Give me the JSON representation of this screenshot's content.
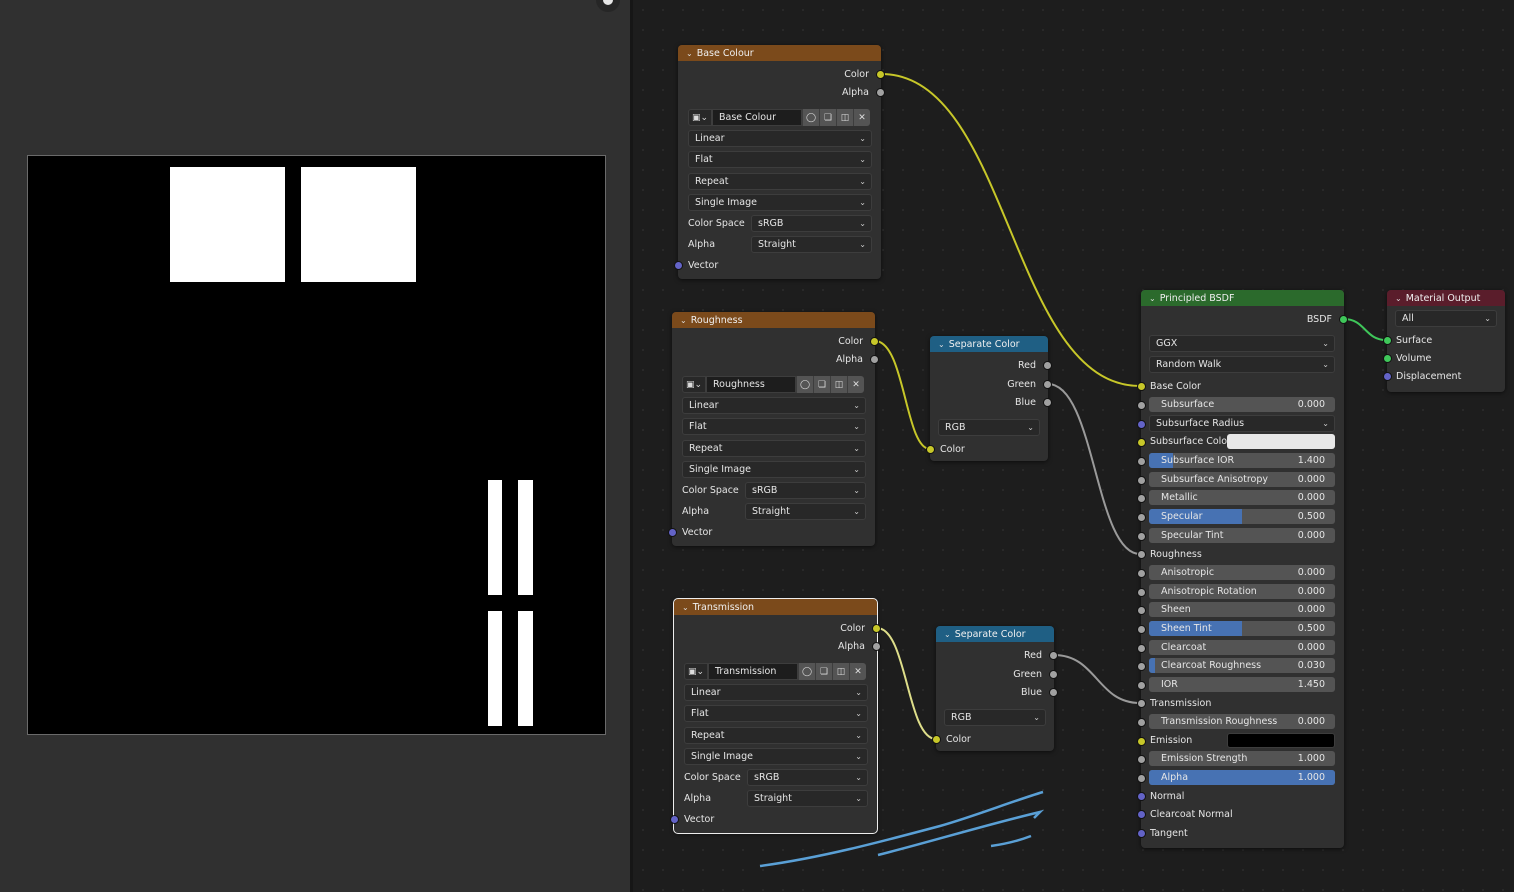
{
  "image_editor": {
    "frame": "image-preview",
    "gizmo_icon": "hand-pan-icon"
  },
  "nodes": {
    "base_colour": {
      "title": "Base Colour",
      "outputs": [
        "Color",
        "Alpha"
      ],
      "image_name": "Base Colour",
      "interpolation": "Linear",
      "projection": "Flat",
      "extension": "Repeat",
      "source": "Single Image",
      "color_space_label": "Color Space",
      "color_space": "sRGB",
      "alpha_label": "Alpha",
      "alpha": "Straight",
      "input": "Vector"
    },
    "roughness": {
      "title": "Roughness",
      "outputs": [
        "Color",
        "Alpha"
      ],
      "image_name": "Roughness",
      "interpolation": "Linear",
      "projection": "Flat",
      "extension": "Repeat",
      "source": "Single Image",
      "color_space_label": "Color Space",
      "color_space": "sRGB",
      "alpha_label": "Alpha",
      "alpha": "Straight",
      "input": "Vector"
    },
    "transmission": {
      "title": "Transmission",
      "outputs": [
        "Color",
        "Alpha"
      ],
      "image_name": "Transmission",
      "interpolation": "Linear",
      "projection": "Flat",
      "extension": "Repeat",
      "source": "Single Image",
      "color_space_label": "Color Space",
      "color_space": "sRGB",
      "alpha_label": "Alpha",
      "alpha": "Straight",
      "input": "Vector"
    },
    "separate_color_1": {
      "title": "Separate Color",
      "outputs": [
        "Red",
        "Green",
        "Blue"
      ],
      "mode": "RGB",
      "input": "Color"
    },
    "separate_color_2": {
      "title": "Separate Color",
      "outputs": [
        "Red",
        "Green",
        "Blue"
      ],
      "mode": "RGB",
      "input": "Color"
    },
    "principled": {
      "title": "Principled BSDF",
      "output": "BSDF",
      "distribution": "GGX",
      "subsurface_method": "Random Walk",
      "inputs": {
        "base_color": "Base Color",
        "subsurface": {
          "label": "Subsurface",
          "value": "0.000",
          "fraction": 0
        },
        "subsurface_radius": "Subsurface Radius",
        "subsurface_color": {
          "label": "Subsurface Color",
          "color": "#e8e8e8"
        },
        "subsurface_ior": {
          "label": "Subsurface IOR",
          "value": "1.400",
          "fraction": 0.13
        },
        "subsurface_anisotropy": {
          "label": "Subsurface Anisotropy",
          "value": "0.000",
          "fraction": 0
        },
        "metallic": {
          "label": "Metallic",
          "value": "0.000",
          "fraction": 0
        },
        "specular": {
          "label": "Specular",
          "value": "0.500",
          "fraction": 0.5
        },
        "specular_tint": {
          "label": "Specular Tint",
          "value": "0.000",
          "fraction": 0
        },
        "roughness": "Roughness",
        "anisotropic": {
          "label": "Anisotropic",
          "value": "0.000",
          "fraction": 0
        },
        "anisotropic_rotation": {
          "label": "Anisotropic Rotation",
          "value": "0.000",
          "fraction": 0
        },
        "sheen": {
          "label": "Sheen",
          "value": "0.000",
          "fraction": 0
        },
        "sheen_tint": {
          "label": "Sheen Tint",
          "value": "0.500",
          "fraction": 0.5
        },
        "clearcoat": {
          "label": "Clearcoat",
          "value": "0.000",
          "fraction": 0
        },
        "clearcoat_roughness": {
          "label": "Clearcoat Roughness",
          "value": "0.030",
          "fraction": 0.03
        },
        "ior": {
          "label": "IOR",
          "value": "1.450",
          "fraction": 0
        },
        "transmission": "Transmission",
        "transmission_roughness": {
          "label": "Transmission Roughness",
          "value": "0.000",
          "fraction": 0
        },
        "emission": {
          "label": "Emission",
          "color": "#000000"
        },
        "emission_strength": {
          "label": "Emission Strength",
          "value": "1.000",
          "fraction": 0
        },
        "alpha": {
          "label": "Alpha",
          "value": "1.000",
          "fraction": 1
        },
        "normal": "Normal",
        "clearcoat_normal": "Clearcoat Normal",
        "tangent": "Tangent"
      }
    },
    "material_output": {
      "title": "Material Output",
      "target": "All",
      "inputs": [
        "Surface",
        "Volume",
        "Displacement"
      ]
    }
  },
  "colors": {
    "texture_header": "#7b4a1b",
    "converter_header": "#1f5f84",
    "shader_header": "#2b6a2c",
    "output_header": "#5a1d2b",
    "slider_fill": "#4772b3",
    "link_yellow": "#c7c729",
    "link_gray": "#9a9a9a",
    "link_green": "#3fc75a",
    "annotation": "#5aa0d6"
  }
}
